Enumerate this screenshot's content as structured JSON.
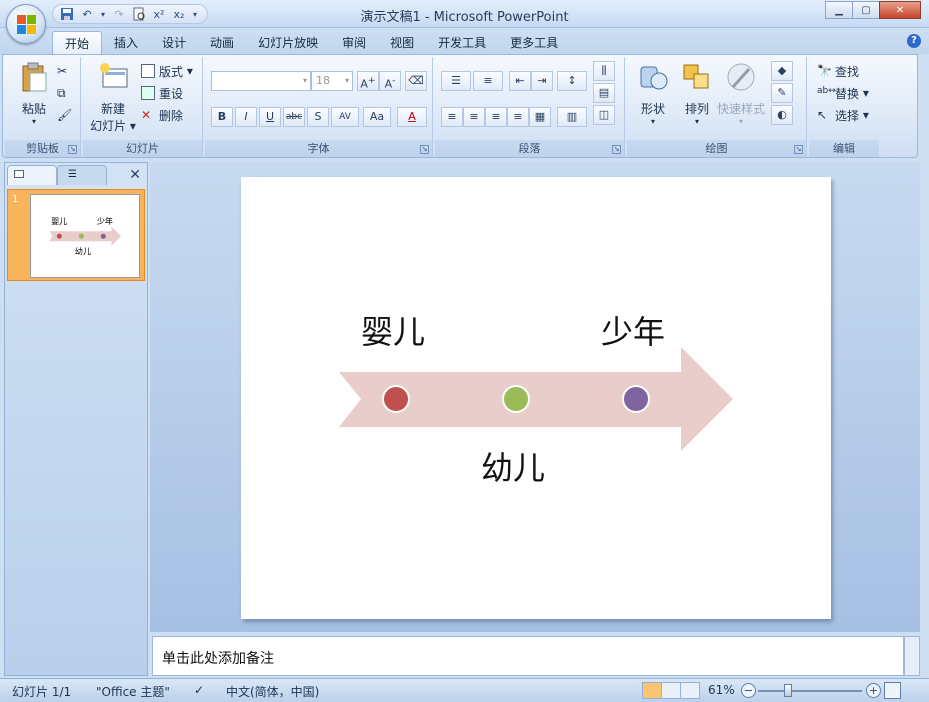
{
  "window": {
    "title": "演示文稿1 - Microsoft PowerPoint"
  },
  "ribbon": {
    "tabs": [
      "开始",
      "插入",
      "设计",
      "动画",
      "幻灯片放映",
      "审阅",
      "视图",
      "开发工具",
      "更多工具"
    ],
    "active_tab": "开始",
    "clipboard": {
      "paste": "粘贴",
      "label": "剪贴板"
    },
    "slides": {
      "new_slide_1": "新建",
      "new_slide_2": "幻灯片",
      "layout": "版式",
      "reset": "重设",
      "delete": "删除",
      "label": "幻灯片"
    },
    "font": {
      "size": "18",
      "label": "字体",
      "bold": "B",
      "italic": "I",
      "underline": "U",
      "strike": "abc",
      "shadow": "S",
      "spacing": "AV",
      "case": "Aa",
      "color": "A"
    },
    "paragraph": {
      "label": "段落"
    },
    "drawing": {
      "shapes": "形状",
      "arrange": "排列",
      "quick_styles": "快速样式",
      "label": "绘图"
    },
    "editing": {
      "find": "查找",
      "replace": "替换",
      "select": "选择",
      "label": "编辑"
    }
  },
  "slide_panel": {
    "slide_number": "1",
    "thumb_labels": [
      "婴儿",
      "少年",
      "幼儿"
    ]
  },
  "slide": {
    "labels": {
      "infant": "婴儿",
      "teen": "少年",
      "toddler": "幼儿"
    },
    "arrow_color": "#e8cdca",
    "dot_colors": [
      "#c0504d",
      "#9bbb59",
      "#8064a2"
    ]
  },
  "notes": {
    "placeholder": "单击此处添加备注"
  },
  "status": {
    "slide_info": "幻灯片 1/1",
    "theme": "\"Office 主题\"",
    "language": "中文(简体，中国)",
    "zoom": "61%"
  }
}
